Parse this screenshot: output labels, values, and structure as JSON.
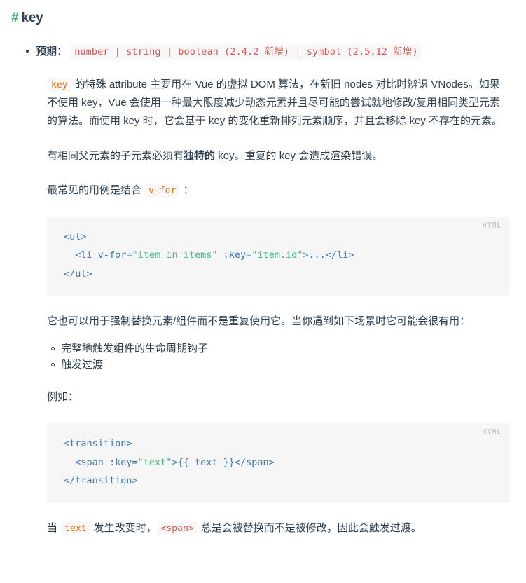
{
  "heading": {
    "anchor": "#",
    "text": "key"
  },
  "colors": {
    "accent_green": "#42b983",
    "text": "#2c3e50",
    "inline_code_bg": "#f8f8f8",
    "inline_code_orange": "#e96900",
    "inline_code_red": "#e05252",
    "codeblock_bg": "#f6f6f7",
    "codeblock_lang": "#c9ccd1",
    "code_tag_blue": "#4078b0",
    "code_string_green": "#42b983"
  },
  "expectation": {
    "label": "预期",
    "separator": "：",
    "types": "number | string | boolean (2.4.2 新增) | symbol (2.5.12 新增)"
  },
  "paragraphs": {
    "p1_code": "key",
    "p1_rest": " 的特殊 attribute 主要用在 Vue 的虚拟 DOM 算法，在新旧 nodes 对比时辨识 VNodes。如果不使用 key，Vue 会使用一种最大限度减少动态元素并且尽可能的尝试就地修改/复用相同类型元素的算法。而使用 key 时，它会基于 key 的变化重新排列元素顺序，并且会移除 key 不存在的元素。",
    "p2_a": "有相同父元素的子元素必须有",
    "p2_bold": "独特的",
    "p2_b": " key。重复的 key 会造成渲染错误。",
    "p3_a": "最常见的用例是结合 ",
    "p3_code": "v-for",
    "p3_b": " ：",
    "p4": "它也可以用于强制替换元素/组件而不是重复使用它。当你遇到如下场景时它可能会很有用：",
    "p5": "例如：",
    "p6_a": "当 ",
    "p6_code1": "text",
    "p6_b": " 发生改变时，",
    "p6_code2": "<span>",
    "p6_c": " 总是会被替换而不是被修改，因此会触发过渡。"
  },
  "bullets": [
    "完整地触发组件的生命周期钩子",
    "触发过渡"
  ],
  "code_blocks": [
    {
      "lang_label": "HTML",
      "lines": [
        [
          {
            "t": "<ul>",
            "c": "tag"
          }
        ],
        [
          {
            "t": "  <li v-for=",
            "c": "tag"
          },
          {
            "t": "\"item in items\"",
            "c": "str"
          },
          {
            "t": " :key=",
            "c": "tag"
          },
          {
            "t": "\"item.id\"",
            "c": "str"
          },
          {
            "t": ">...</li>",
            "c": "tag"
          }
        ],
        [
          {
            "t": "</ul>",
            "c": "tag"
          }
        ]
      ]
    },
    {
      "lang_label": "HTML",
      "lines": [
        [
          {
            "t": "<transition>",
            "c": "tag"
          }
        ],
        [
          {
            "t": "  <span :key=",
            "c": "tag"
          },
          {
            "t": "\"text\"",
            "c": "str"
          },
          {
            "t": ">{{ text }}</span>",
            "c": "tag"
          }
        ],
        [
          {
            "t": "</transition>",
            "c": "tag"
          }
        ]
      ]
    }
  ]
}
